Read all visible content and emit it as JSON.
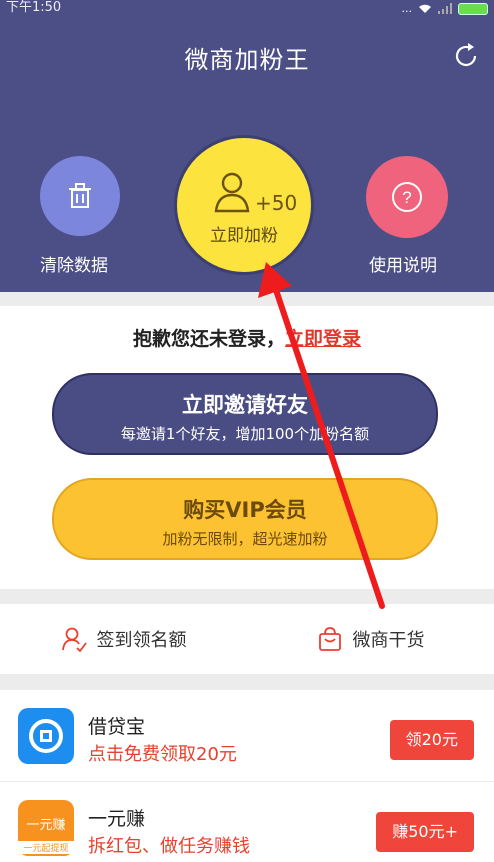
{
  "status_bar": {
    "time": "下午1:50",
    "dots": "..."
  },
  "header": {
    "title": "微商加粉王",
    "clear_label": "清除数据",
    "add_plus": "+50",
    "add_label": "立即加粉",
    "help_label": "使用说明"
  },
  "login": {
    "prefix": "抱歉您还未登录，",
    "link": "立即登录"
  },
  "invite": {
    "title": "立即邀请好友",
    "subtitle": "每邀请1个好友，增加100个加粉名额"
  },
  "vip": {
    "title": "购买VIP会员",
    "subtitle": "加粉无限制，超光速加粉"
  },
  "shortcuts": {
    "checkin": "签到领名额",
    "goods": "微商干货"
  },
  "apps": [
    {
      "name": "借贷宝",
      "desc": "点击免费领取20元",
      "button": "领20元",
      "icon_color": "#1d8ef0"
    },
    {
      "name": "一元赚",
      "desc": "拆红包、做任务赚钱",
      "button": "赚50元+",
      "icon_color": "#f7921e",
      "icon_text": "一元赚",
      "icon_subtext": "一元起提现"
    }
  ],
  "colors": {
    "header": "#4b4f86",
    "accent_red": "#e2372b",
    "yellow": "#fde33d",
    "pink": "#f0637c",
    "lavender": "#7d86dd"
  }
}
